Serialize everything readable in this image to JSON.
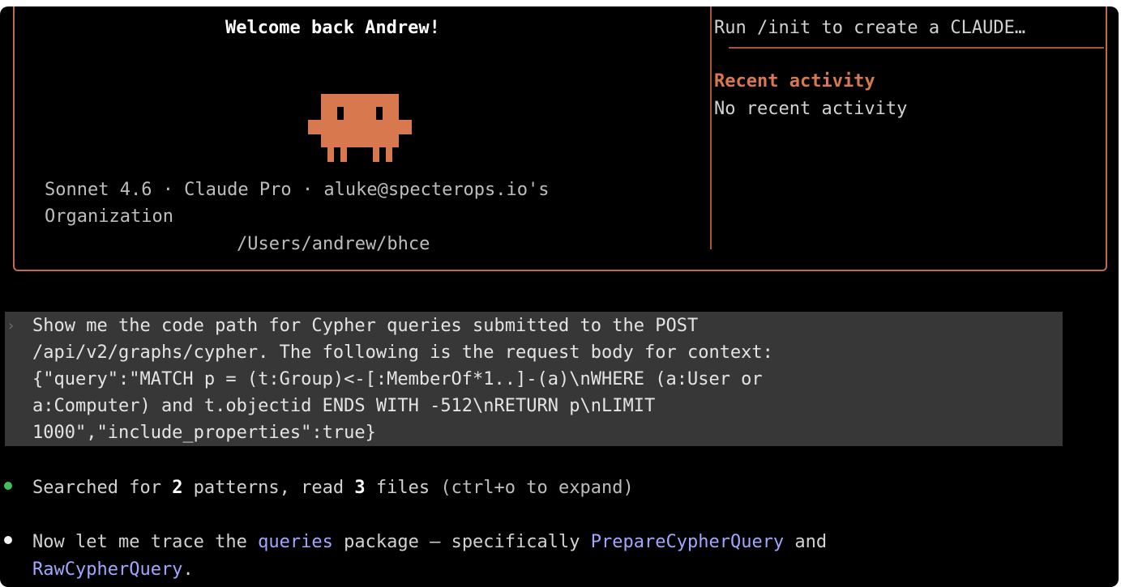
{
  "welcome": {
    "greeting": "Welcome back Andrew!",
    "model_line": "Sonnet 4.6 · Claude Pro · aluke@specterops.io's",
    "org_line": "Organization",
    "path": "/Users/andrew/bhce"
  },
  "tips": {
    "init_text": "Run /init to create a CLAUDE…",
    "recent_title": "Recent activity",
    "recent_text": "No recent activity"
  },
  "prompt": {
    "caret": "›",
    "lines": [
      "Show me the code path for Cypher queries submitted to the POST",
      "/api/v2/graphs/cypher. The following is the request body for context:",
      "{\"query\":\"MATCH p = (t:Group)<-[:MemberOf*1..]-(a)\\nWHERE (a:User or",
      "a:Computer) and t.objectid ENDS WITH -512\\nRETURN p\\nLIMIT",
      "1000\",\"include_properties\":true}"
    ]
  },
  "activity": {
    "search_prefix": "Searched for ",
    "pattern_count": "2",
    "search_mid": " patterns, read ",
    "file_count": "3",
    "search_mid2": " files ",
    "search_hint": "(ctrl+o to expand)",
    "trace_1": "Now let me trace the ",
    "trace_pkg": "queries",
    "trace_2": " package — specifically ",
    "trace_fn1": "PrepareCypherQuery",
    "trace_3": " and",
    "trace_fn2": "RawCypherQuery",
    "trace_end": "."
  },
  "colors": {
    "accent": "#d8784f",
    "border": "#c26a4e",
    "success_dot": "#3fbf5f",
    "link": "#a3a6ff"
  },
  "icons": {
    "mascot": "claude-mascot-icon",
    "status_done": "green-dot-icon",
    "status_message": "white-dot-icon"
  }
}
